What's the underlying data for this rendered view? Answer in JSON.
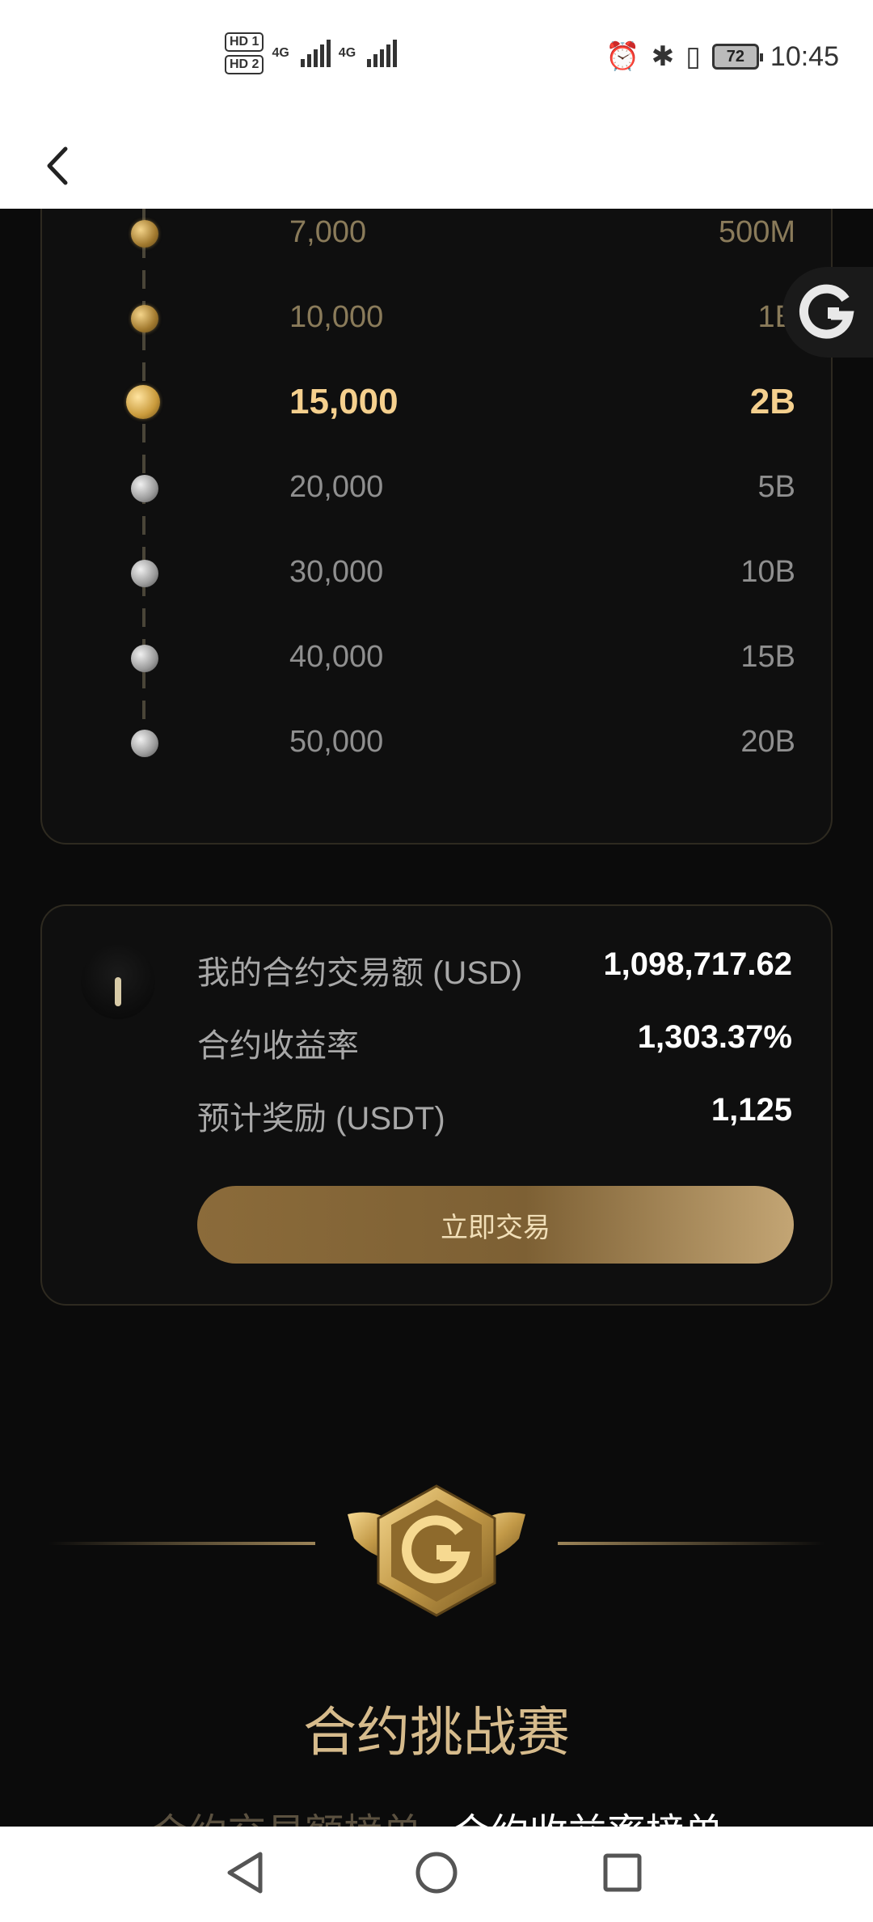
{
  "status_bar": {
    "hd1": "HD 1",
    "hd2": "HD 2",
    "net1": "4G",
    "net2": "4G",
    "battery": "72",
    "time": "10:45"
  },
  "tiers": [
    {
      "amount": "7,000",
      "volume": "500M",
      "coin": "gold",
      "current": false
    },
    {
      "amount": "10,000",
      "volume": "1B",
      "coin": "gold",
      "current": false
    },
    {
      "amount": "15,000",
      "volume": "2B",
      "coin": "gold",
      "current": true
    },
    {
      "amount": "20,000",
      "volume": "5B",
      "coin": "silver",
      "current": false
    },
    {
      "amount": "30,000",
      "volume": "10B",
      "coin": "silver",
      "current": false
    },
    {
      "amount": "40,000",
      "volume": "15B",
      "coin": "silver",
      "current": false
    },
    {
      "amount": "50,000",
      "volume": "20B",
      "coin": "silver",
      "current": false
    }
  ],
  "stats": {
    "volume_label": "我的合约交易额 (USD)",
    "volume_value": "1,098,717.62",
    "yield_label": "合约收益率",
    "yield_value": "1,303.37%",
    "reward_label": "预计奖励 (USDT)",
    "reward_value": "1,125",
    "trade_button": "立即交易"
  },
  "section": {
    "title": "合约挑战赛",
    "tab_volume": "合约交易额榜单",
    "tab_yield": "合约收益率榜单"
  },
  "colors": {
    "gold": "#f5d08e",
    "accent": "#8b6b3a",
    "background": "#0b0b0b"
  }
}
